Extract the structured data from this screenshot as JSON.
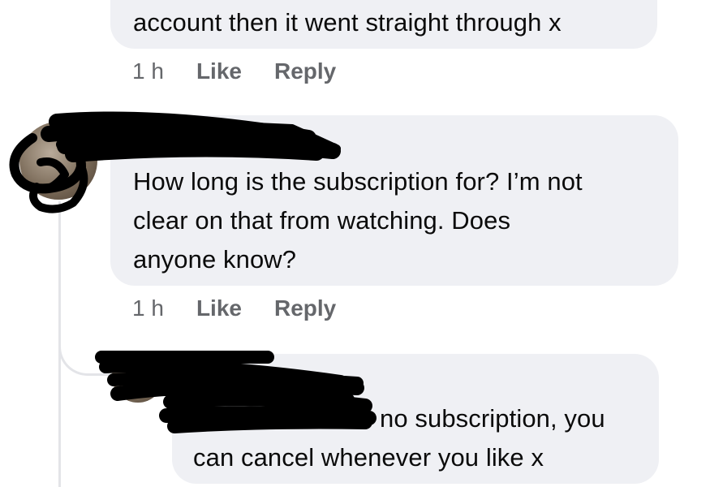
{
  "comments": [
    {
      "text": "account then it went straight through x",
      "time": "1 h",
      "like_label": "Like",
      "reply_label": "Reply"
    },
    {
      "text_lines": [
        "How long is the subscription for? I’m not",
        "clear on that from watching. Does",
        "anyone know?"
      ],
      "time": "1 h",
      "like_label": "Like",
      "reply_label": "Reply"
    },
    {
      "text_lines": [
        "no subscription, you",
        "can cancel whenever you like x"
      ]
    }
  ]
}
